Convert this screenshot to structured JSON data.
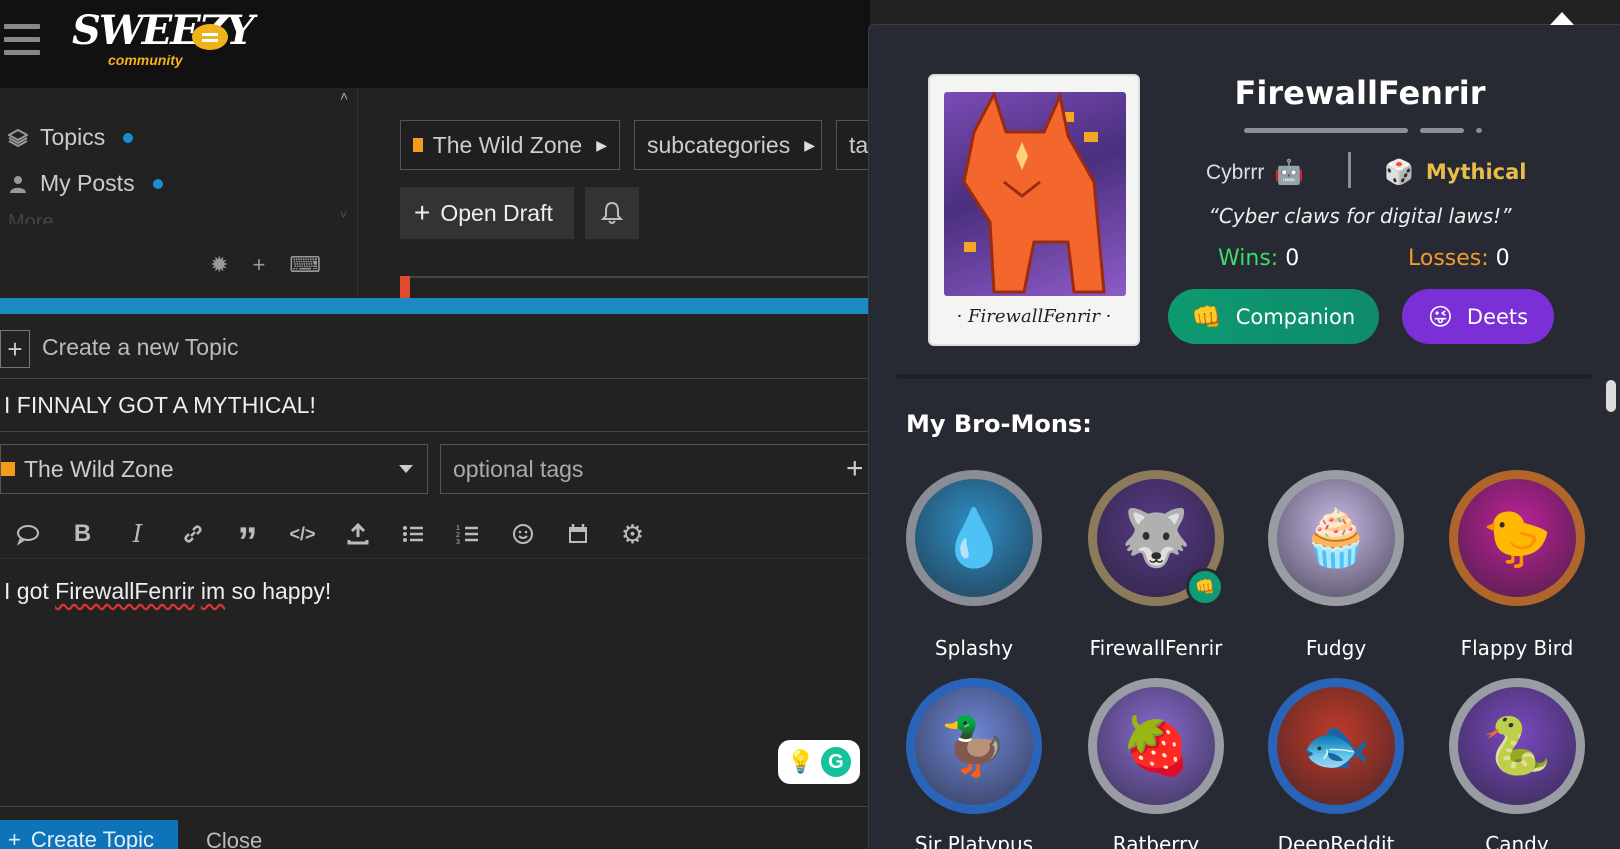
{
  "header": {
    "logo_word": "SWEEZY",
    "logo_sub": "community"
  },
  "sidebar": {
    "items": [
      {
        "label": "Topics"
      },
      {
        "label": "My Posts"
      }
    ],
    "more_label": "More",
    "tools": [
      "gear-icon",
      "plus-icon",
      "keyboard-icon"
    ]
  },
  "breadcrumbs": [
    {
      "label": "The Wild Zone",
      "color": "#f49a1c"
    },
    {
      "label": "subcategories"
    },
    {
      "label": "ta"
    }
  ],
  "actions": {
    "open_draft": "Open Draft"
  },
  "composer": {
    "create_label": "Create a new Topic",
    "title_value": "I FINNALY GOT A MYTHICAL!",
    "category": "The Wild Zone",
    "category_color": "#f49a1c",
    "tags_placeholder": "optional tags",
    "body_before": "I got ",
    "body_misspelled_1": "FirewallFenrir",
    "body_middle": " ",
    "body_misspelled_2": "im",
    "body_after": " so happy!",
    "toolbar_icons": [
      "quote-bubble-icon",
      "bold-icon",
      "italic-icon",
      "link-icon",
      "blockquote-icon",
      "code-icon",
      "upload-icon",
      "bullet-list-icon",
      "numbered-list-icon",
      "emoji-icon",
      "calendar-icon",
      "gear-icon"
    ],
    "submit_label": "Create Topic",
    "close_label": "Close"
  },
  "profile": {
    "username": "FirewallFenrir",
    "card_name": "· FirewallFenrir ·",
    "type": "Cybrrr",
    "rarity": "Mythical",
    "quote": "“Cyber claws for digital laws!”",
    "wins_label": "Wins:",
    "wins": "0",
    "losses_label": "Losses:",
    "losses": "0",
    "companion_label": "Companion",
    "deets_label": "Deets",
    "colors": {
      "wins": "#3ddc6a",
      "losses": "#f39a2b",
      "rarity": "#e9bd4a"
    }
  },
  "bromons": {
    "heading": "My Bro-Mons:",
    "items": [
      {
        "name": "Splashy",
        "ring": "#8a8d95",
        "bg": "#2f8fc6"
      },
      {
        "name": "FirewallFenrir",
        "ring": "#8c7a5a",
        "bg": "#5a3a8a",
        "companion": true
      },
      {
        "name": "Fudgy",
        "ring": "#9a9ca4",
        "bg": "#c9b8e6"
      },
      {
        "name": "Flappy Bird",
        "ring": "#b0662a",
        "bg": "#c0229a"
      },
      {
        "name": "Sir Platypus",
        "ring": "#2a64b8",
        "bg": "#6f86d8"
      },
      {
        "name": "Ratberry",
        "ring": "#9a9ca4",
        "bg": "#8a6ad0"
      },
      {
        "name": "DeepReddit",
        "ring": "#2a64b8",
        "bg": "#c03a2a"
      },
      {
        "name": "Candy",
        "ring": "#9a9ca4",
        "bg": "#7a4ac0"
      }
    ]
  }
}
